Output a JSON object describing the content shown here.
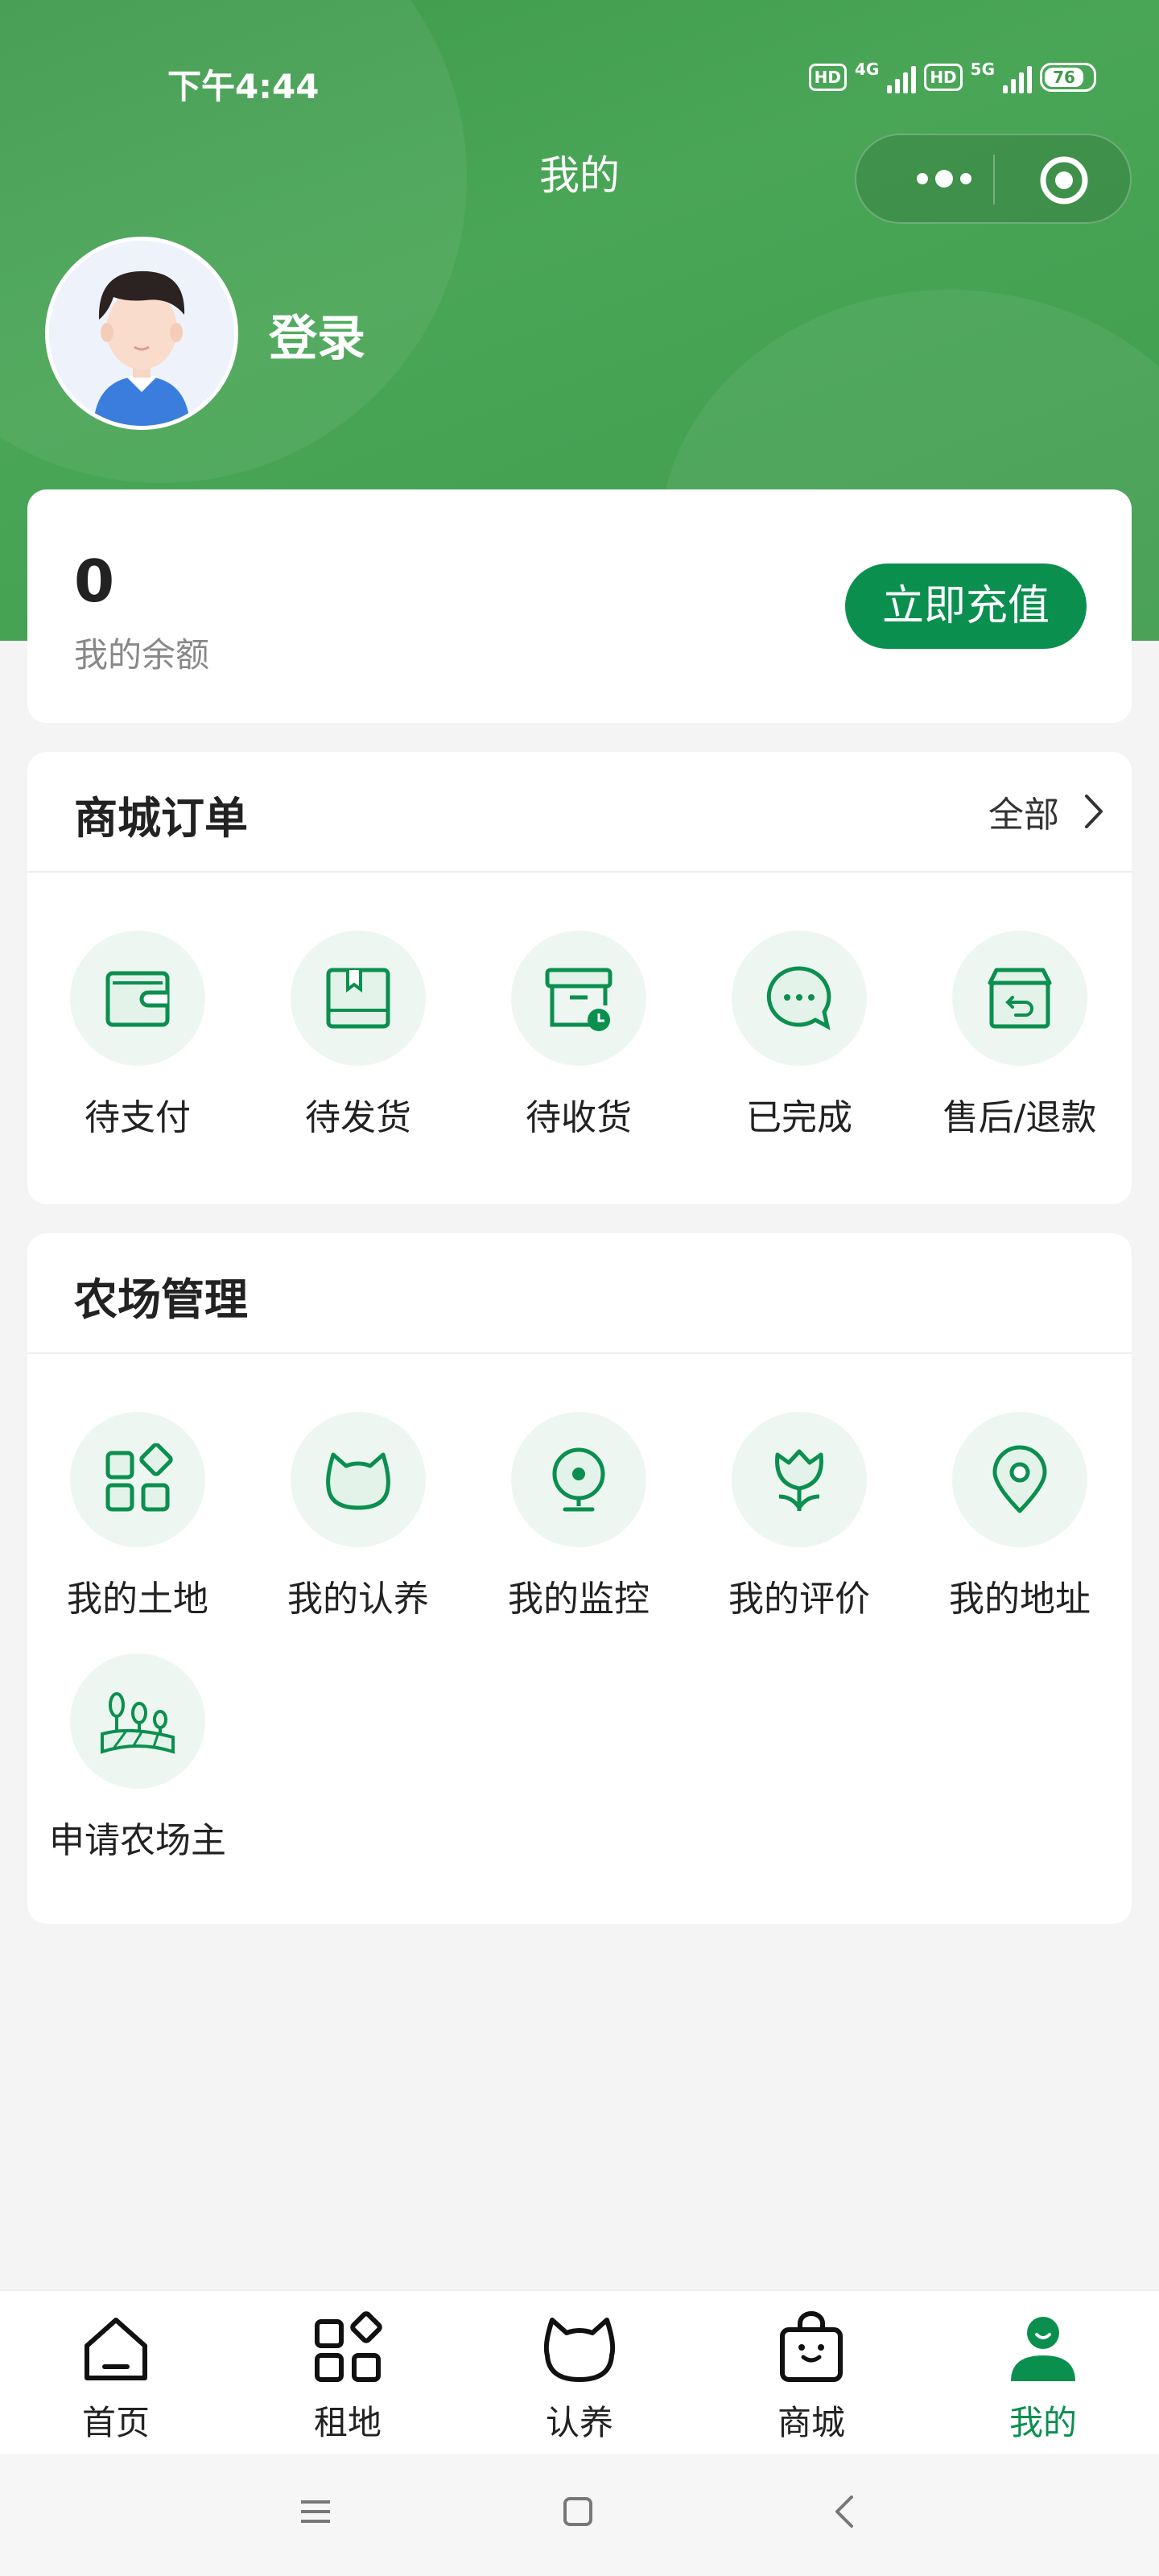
{
  "status": {
    "time": "下午4:44",
    "hd1": "HD",
    "net1": "4G",
    "hd2": "HD",
    "net2": "5G",
    "battery": "76"
  },
  "header": {
    "title": "我的"
  },
  "user": {
    "login": "登录"
  },
  "balance": {
    "value": "0",
    "label": "我的余额",
    "button": "立即充值"
  },
  "orders": {
    "title": "商城订单",
    "all": "全部",
    "items": [
      {
        "label": "待支付",
        "icon": "wallet-icon"
      },
      {
        "label": "待发货",
        "icon": "package-icon"
      },
      {
        "label": "待收货",
        "icon": "delivery-box-icon"
      },
      {
        "label": "已完成",
        "icon": "chat-bubble-icon"
      },
      {
        "label": "售后/退款",
        "icon": "return-box-icon"
      }
    ]
  },
  "farm": {
    "title": "农场管理",
    "items": [
      {
        "label": "我的土地",
        "icon": "grid-blocks-icon"
      },
      {
        "label": "我的认养",
        "icon": "cat-head-icon"
      },
      {
        "label": "我的监控",
        "icon": "camera-icon"
      },
      {
        "label": "我的评价",
        "icon": "tulip-icon"
      },
      {
        "label": "我的地址",
        "icon": "location-pin-icon"
      },
      {
        "label": "申请农场主",
        "icon": "farm-field-icon"
      }
    ]
  },
  "tabbar": {
    "items": [
      {
        "label": "首页",
        "icon": "home-icon"
      },
      {
        "label": "租地",
        "icon": "grid-blocks-icon"
      },
      {
        "label": "认养",
        "icon": "cat-head-icon"
      },
      {
        "label": "商城",
        "icon": "shopping-bag-icon"
      },
      {
        "label": "我的",
        "icon": "person-icon"
      }
    ],
    "active": "我的"
  },
  "colors": {
    "brand": "#0b8f4f",
    "header": "#45a152",
    "icon_bg": "#eef6f1"
  }
}
